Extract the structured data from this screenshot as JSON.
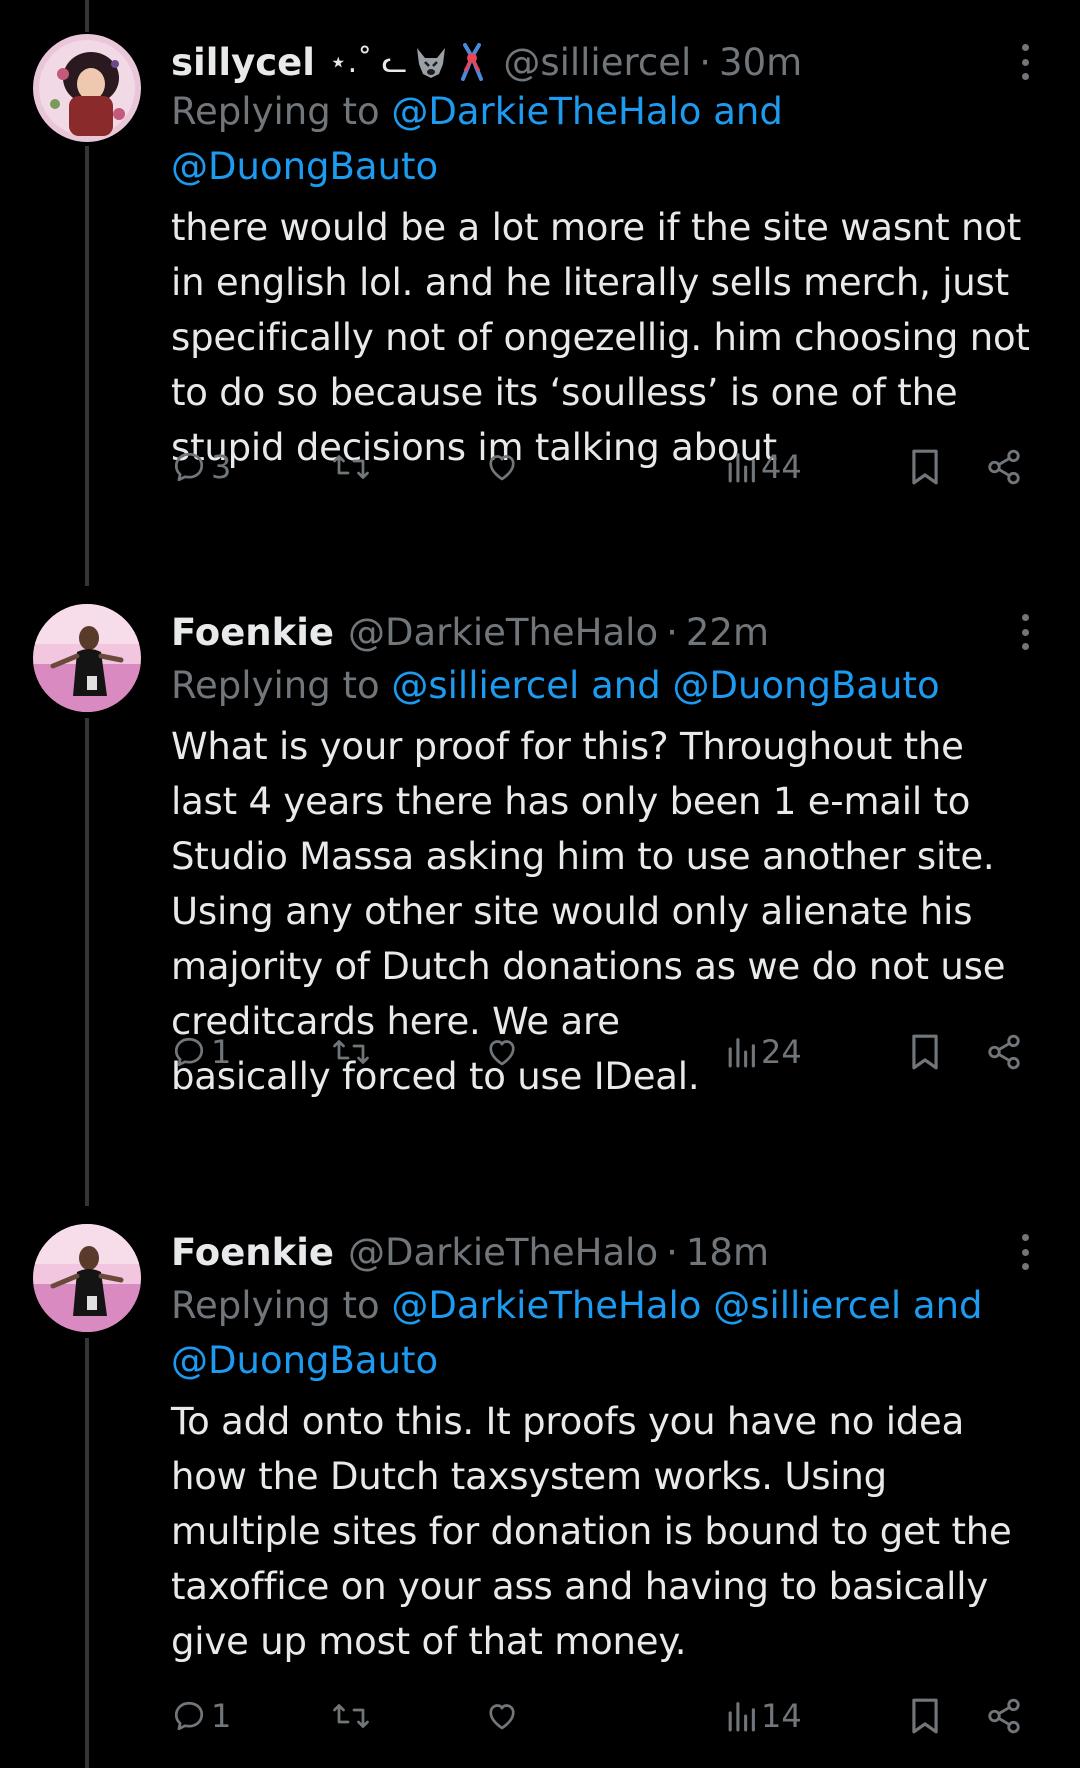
{
  "tweets": [
    {
      "name": "sillycel",
      "name_symbols": "⋆.˚ ᓚ",
      "handle": "@silliercel",
      "time": "30m",
      "replying_prefix": "Replying to",
      "replying_mentions": "@DarkieTheHalo and",
      "replying_mentions_2": "@DuongBauto",
      "body_lines": [
        "there would be a lot more if the site wasnt not",
        "in english lol. and he literally sells merch, just",
        "specifically not of ongezellig. him choosing not",
        "to do so because its ‘soulless’ is one of the",
        "stupid decisions im talking about"
      ],
      "replies": "3",
      "retweets": "",
      "likes": "",
      "views": "44"
    },
    {
      "name": "Foenkie",
      "handle": "@DarkieTheHalo",
      "time": "22m",
      "replying_prefix": "Replying to",
      "replying_mentions": "@silliercel and @DuongBauto",
      "body_lines": [
        "What is your proof for this? Throughout the",
        "last 4 years there has only been 1 e-mail to",
        "Studio Massa asking him to use another site.",
        "Using any other site would only alienate his",
        "majority of Dutch donations as we do not use",
        "creditcards here. We are",
        "basically forced to use IDeal."
      ],
      "replies": "1",
      "retweets": "",
      "likes": "",
      "views": "24"
    },
    {
      "name": "Foenkie",
      "handle": "@DarkieTheHalo",
      "time": "18m",
      "replying_prefix": "Replying to",
      "replying_mentions": "@DarkieTheHalo @silliercel and",
      "replying_mentions_2": "@DuongBauto",
      "body_lines": [
        "To add onto this. It proofs you have no idea",
        "how the Dutch taxsystem works. Using",
        "multiple sites for donation is bound to get the",
        "taxoffice on your ass and having to basically",
        "give up most of that money."
      ],
      "replies": "1",
      "retweets": "",
      "likes": "",
      "views": "14"
    }
  ],
  "icons": {
    "reply": "reply-icon",
    "retweet": "retweet-icon",
    "like": "heart-icon",
    "views": "views-icon",
    "bookmark": "bookmark-icon",
    "share": "share-icon",
    "more": "more-icon"
  },
  "colors": {
    "background": "#000000",
    "text": "#e7e9ea",
    "secondary": "#71767b",
    "link": "#1d9bf0",
    "thread_line": "#333639"
  }
}
